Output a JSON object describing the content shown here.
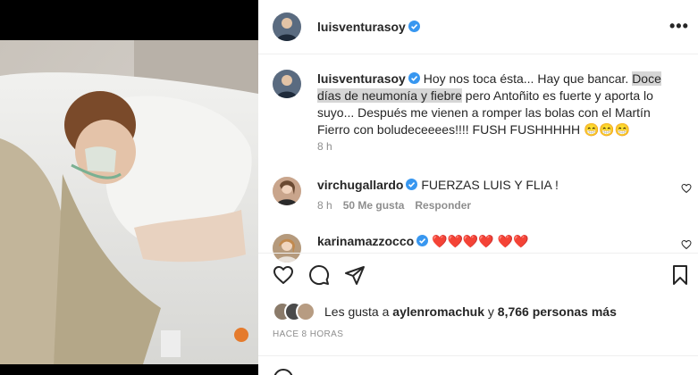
{
  "header": {
    "username": "luisventurasoy",
    "more_label": "•••"
  },
  "caption": {
    "username": "luisventurasoy",
    "text_1": " Hoy nos toca ésta... Hay que bancar. ",
    "highlight_1": "Doce",
    "highlight_2": "días de neumonía y fiebre",
    "text_2": " pero Antoñito es fuerte y aporta lo suyo... Después me vienen a romper las bolas con el Martín Fierro con boludeceeees!!!! FUSH FUSHHHHH 😁😁😁",
    "time": "8 h"
  },
  "comments": [
    {
      "username": "virchugallardo",
      "text": " FUERZAS LUIS Y FLIA !",
      "time": "8 h",
      "likes": "50 Me gusta",
      "reply": "Responder"
    },
    {
      "username": "karinamazzocco",
      "text": " ❤️❤️❤️❤️ ❤️❤️"
    }
  ],
  "likes": {
    "prefix": "Les gusta a ",
    "user": "aylenromachuk",
    "middle": " y ",
    "count": "8,766 personas más"
  },
  "timestamp": "HACE 8 HORAS",
  "colors": {
    "verified": "#3897f0",
    "text": "#262626",
    "muted": "#8e8e8e",
    "highlight": "#d6d6d6"
  }
}
